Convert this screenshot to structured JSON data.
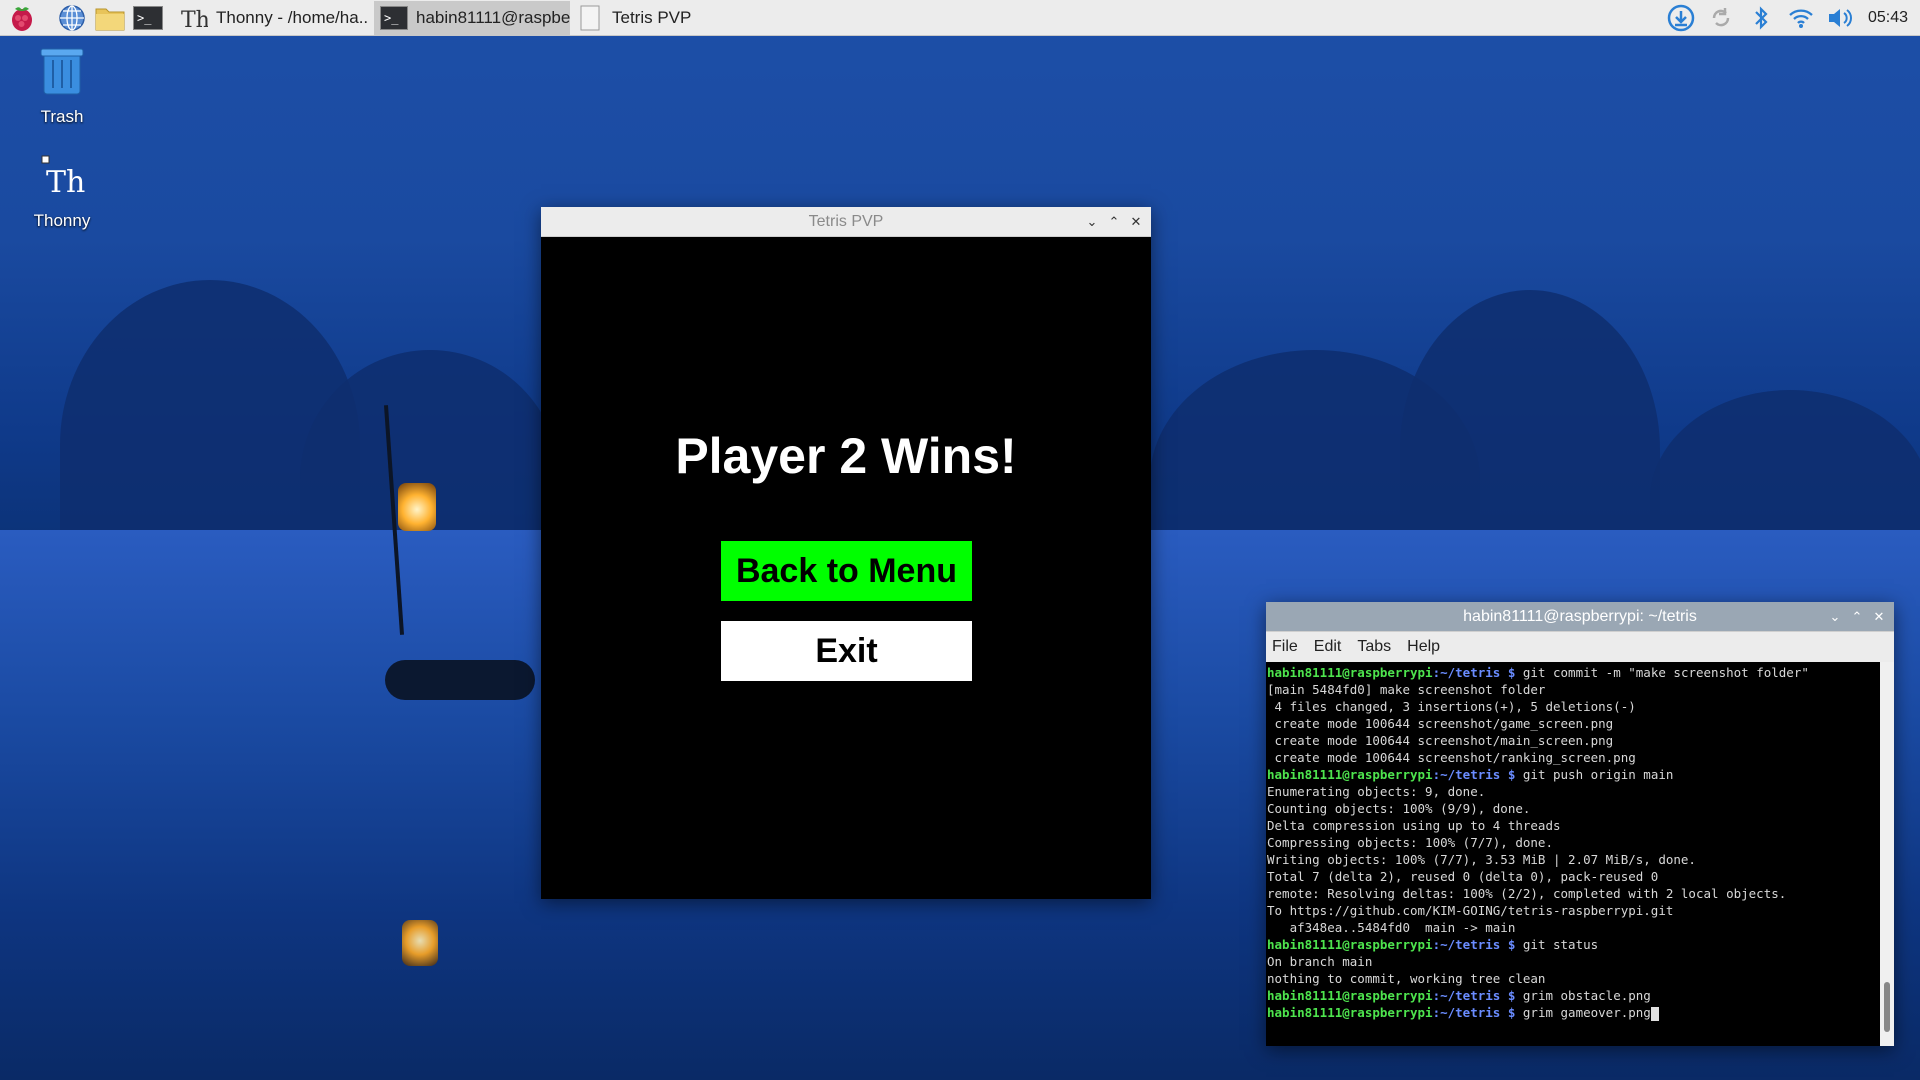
{
  "taskbar": {
    "tasks": [
      {
        "label": "Thonny  -  /home/ha.."
      },
      {
        "label": "habin81111@raspbe.."
      },
      {
        "label": "Tetris PVP"
      }
    ],
    "clock": "05:43"
  },
  "desktop": {
    "icons": [
      {
        "label": "Trash"
      },
      {
        "label": "Thonny"
      }
    ]
  },
  "tetris_window": {
    "title": "Tetris PVP",
    "heading": "Player 2 Wins!",
    "back_button": "Back to Menu",
    "exit_button": "Exit"
  },
  "terminal": {
    "title": "habin81111@raspberrypi: ~/tetris",
    "menu": [
      "File",
      "Edit",
      "Tabs",
      "Help"
    ],
    "prompt_user": "habin81111@raspberrypi",
    "prompt_path": ":~/tetris $",
    "lines": [
      {
        "cmd": " git commit -m \"make screenshot folder\""
      },
      {
        "out": "[main 5484fd0] make screenshot folder"
      },
      {
        "out": " 4 files changed, 3 insertions(+), 5 deletions(-)"
      },
      {
        "out": " create mode 100644 screenshot/game_screen.png"
      },
      {
        "out": " create mode 100644 screenshot/main_screen.png"
      },
      {
        "out": " create mode 100644 screenshot/ranking_screen.png"
      },
      {
        "cmd": " git push origin main"
      },
      {
        "out": "Enumerating objects: 9, done."
      },
      {
        "out": "Counting objects: 100% (9/9), done."
      },
      {
        "out": "Delta compression using up to 4 threads"
      },
      {
        "out": "Compressing objects: 100% (7/7), done."
      },
      {
        "out": "Writing objects: 100% (7/7), 3.53 MiB | 2.07 MiB/s, done."
      },
      {
        "out": "Total 7 (delta 2), reused 0 (delta 0), pack-reused 0"
      },
      {
        "out": "remote: Resolving deltas: 100% (2/2), completed with 2 local objects."
      },
      {
        "out": "To https://github.com/KIM-GOING/tetris-raspberrypi.git"
      },
      {
        "out": "   af348ea..5484fd0  main -> main"
      },
      {
        "cmd": " git status"
      },
      {
        "out": "On branch main"
      },
      {
        "out": "nothing to commit, working tree clean"
      },
      {
        "cmd": " grim obstacle.png"
      },
      {
        "cmd": " grim gameover.png",
        "cursor": true
      }
    ]
  },
  "colors": {
    "menu_button": "#00ff00",
    "prompt_user": "#4ee44e",
    "prompt_path": "#6a8cff"
  }
}
